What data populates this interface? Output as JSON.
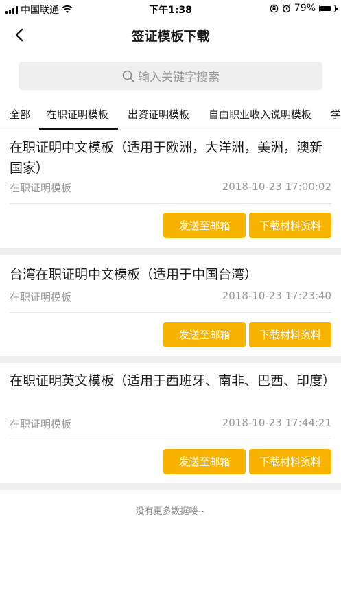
{
  "status_bar": {
    "carrier": "中国联通",
    "time": "下午1:38",
    "battery": "79%",
    "battery_level": 0.79
  },
  "nav": {
    "title": "签证模板下载"
  },
  "search": {
    "placeholder": "输入关键字搜索"
  },
  "tabs": [
    {
      "label": "全部"
    },
    {
      "label": "在职证明模板"
    },
    {
      "label": "出资证明模板"
    },
    {
      "label": "自由职业收入说明模板"
    },
    {
      "label": "学"
    }
  ],
  "items": [
    {
      "title": "在职证明中文模板（适用于欧洲，大洋洲，美洲，澳新国家）",
      "category": "在职证明模板",
      "date": "2018-10-23 17:00:02",
      "email_label": "发送至邮箱",
      "download_label": "下载材料资料"
    },
    {
      "title": "台湾在职证明中文模板（适用于中国台湾）",
      "category": "在职证明模板",
      "date": "2018-10-23 17:23:40",
      "email_label": "发送至邮箱",
      "download_label": "下载材料资料"
    },
    {
      "title": "在职证明英文模板（适用于西班牙、南非、巴西、印度）",
      "category": "在职证明模板",
      "date": "2018-10-23 17:44:21",
      "email_label": "发送至邮箱",
      "download_label": "下载材料资料"
    }
  ],
  "footer": {
    "no_more": "没有更多数据喽~"
  },
  "colors": {
    "accent": "#f8b300",
    "muted_text": "#9a9a9a",
    "separator": "#efefef"
  }
}
